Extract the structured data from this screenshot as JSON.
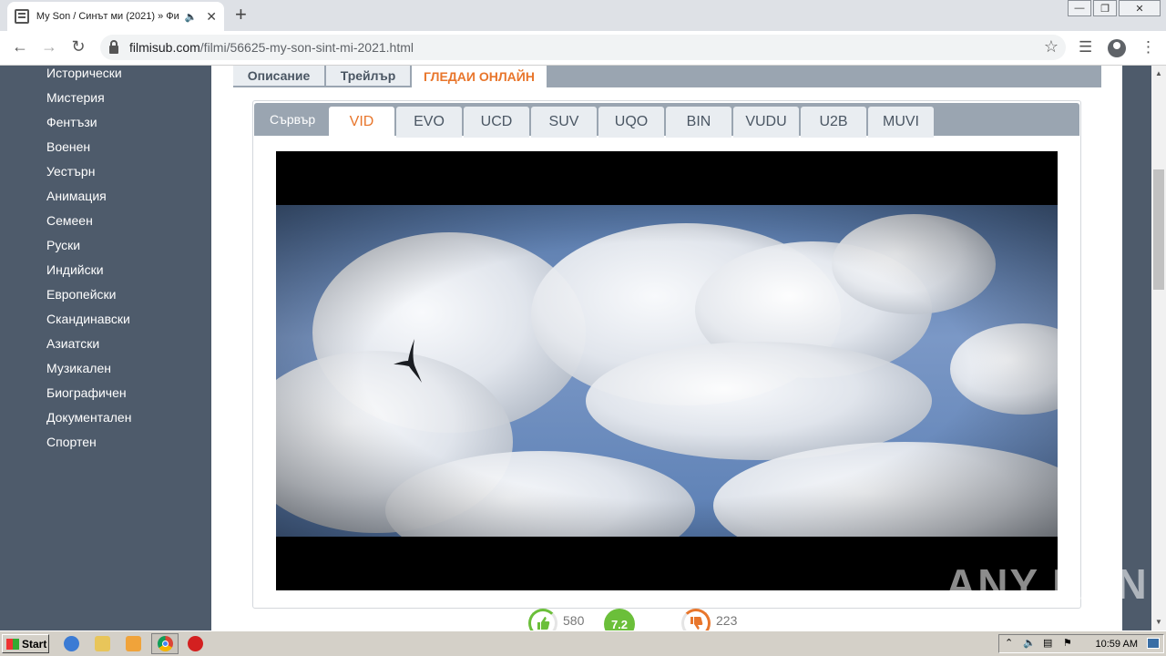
{
  "browser": {
    "tab_title": "My Son / Синът ми (2021) » Фи",
    "url_host": "filmisub.com",
    "url_path": "/filmi/56625-my-son-sint-mi-2021.html"
  },
  "sidebar": {
    "items": [
      {
        "label": "Исторически"
      },
      {
        "label": "Мистерия"
      },
      {
        "label": "Фентъзи"
      },
      {
        "label": "Военен"
      },
      {
        "label": "Уестърн"
      },
      {
        "label": "Анимация"
      },
      {
        "label": "Семеен"
      },
      {
        "label": "Руски"
      },
      {
        "label": "Индийски"
      },
      {
        "label": "Европейски"
      },
      {
        "label": "Скандинавски"
      },
      {
        "label": "Азиатски"
      },
      {
        "label": "Музикален"
      },
      {
        "label": "Биографичен"
      },
      {
        "label": "Документален"
      },
      {
        "label": "Спортен"
      }
    ]
  },
  "content_tabs": [
    {
      "label": "Описание"
    },
    {
      "label": "Трейлър"
    },
    {
      "label": "ГЛЕДАИ ОНЛАЙН"
    }
  ],
  "server": {
    "label": "Сървър",
    "tabs": [
      "VID",
      "EVO",
      "UCD",
      "SUV",
      "UQO",
      "BIN",
      "VUDU",
      "U2B",
      "MUVI"
    ]
  },
  "ratings": {
    "likes": "580",
    "score": "7.2",
    "dislikes": "223"
  },
  "watermark": "ANY RUN",
  "taskbar": {
    "start_label": "Start",
    "clock": "10:59 AM"
  }
}
